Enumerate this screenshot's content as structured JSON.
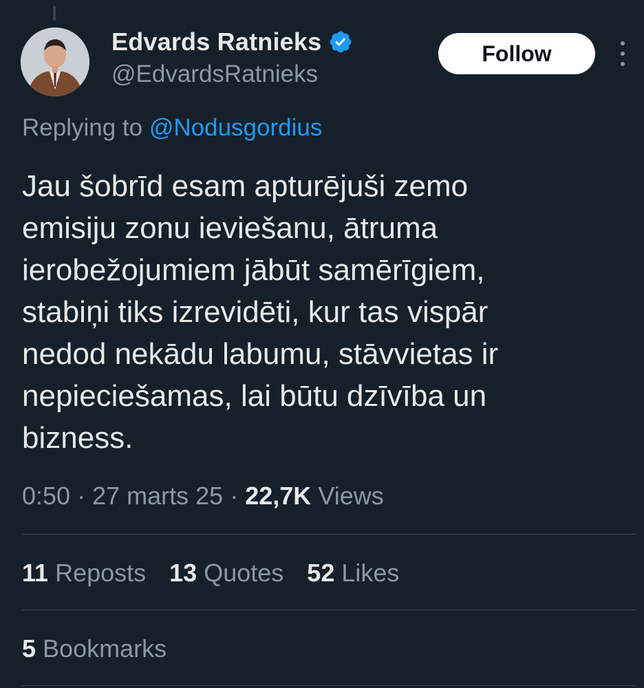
{
  "author": {
    "display_name": "Edvards Ratnieks",
    "handle": "@EdvardsRatnieks",
    "verified": true,
    "verified_color": "#1d9bf0"
  },
  "follow_button": {
    "label": "Follow"
  },
  "more_menu": {
    "icon": "more-vertical-icon"
  },
  "reply_context": {
    "prefix": "Replying to",
    "mention": "@Nodusgordius"
  },
  "tweet": {
    "text": "Jau šobrīd esam apturējuši zemo\nemisiju zonu ieviešanu, ātruma\nierobežojumiem jābūt samērīgiem,\nstabiņi tiks izrevidēti, kur tas vispār\nnedod nekādu labumu, stāvvietas ir\nnepieciešamas, lai būtu dzīvība un\nbizness."
  },
  "meta": {
    "time": "0:50",
    "separator": "·",
    "date": "27 marts 25",
    "views_count": "22,7K",
    "views_label": "Views"
  },
  "stats": {
    "reposts": {
      "count": "11",
      "label": "Reposts"
    },
    "quotes": {
      "count": "13",
      "label": "Quotes"
    },
    "likes": {
      "count": "52",
      "label": "Likes"
    },
    "bookmarks": {
      "count": "5",
      "label": "Bookmarks"
    }
  },
  "colors": {
    "background": "#15202b",
    "text_primary": "#e7e9ea",
    "text_secondary": "#8b98a5",
    "link": "#1d9bf0",
    "divider": "#38444d"
  }
}
